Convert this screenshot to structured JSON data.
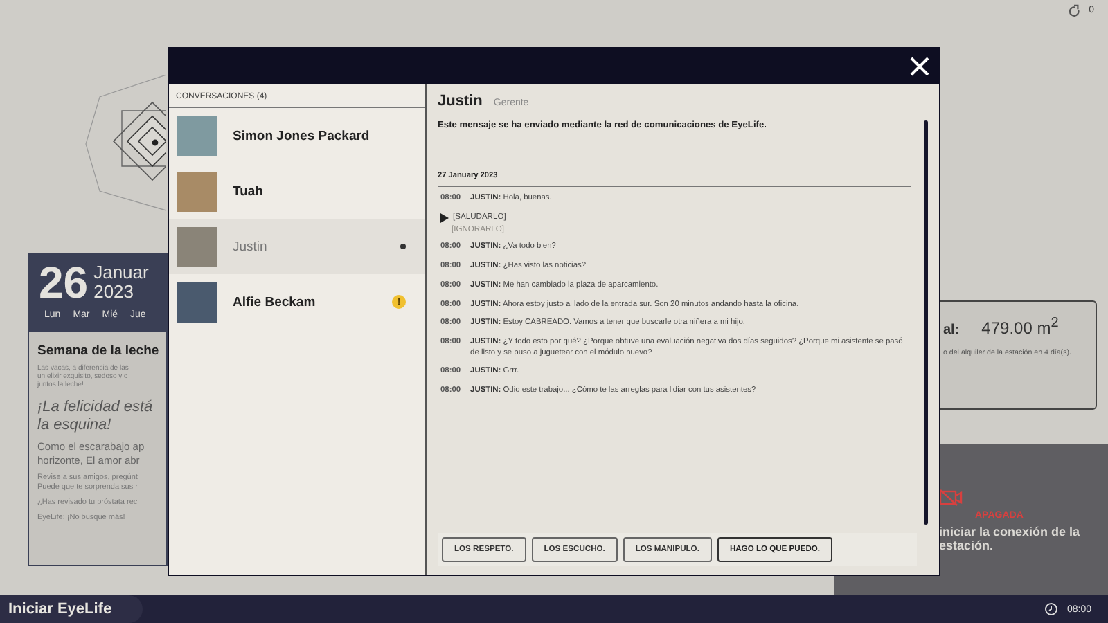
{
  "top_bar": {
    "counter": "0"
  },
  "calendar": {
    "day": "26",
    "month": "Januar",
    "year": "2023",
    "weekdays": [
      "Lun",
      "Mar",
      "Mié",
      "Jue"
    ],
    "title": "Semana de la leche",
    "intro": [
      "Las vacas, a diferencia de las",
      "un elixir exquisito, sedoso y c",
      "juntos la leche!"
    ],
    "slogan": [
      "¡La felicidad está",
      "la esquina!"
    ],
    "body": [
      "Como el escarabajo ap",
      "horizonte, El amor abr"
    ],
    "notes": [
      [
        "Revise a sus amigos, pregúnt",
        "Puede que te sorprenda sus r"
      ],
      [
        "¿Has revisado tu próstata rec"
      ],
      [
        "EyeLife: ¡No busque más!"
      ]
    ]
  },
  "stats": {
    "label": "al:",
    "value": "479.00 m$^{2}$",
    "note": "o del alquiler de la estación en 4 día(s)."
  },
  "connection": {
    "status": "APAGADA",
    "message": "iniciar la conexión de la estación."
  },
  "modal": {
    "list_title": "CONVERSACIONES (4)",
    "conversations": [
      {
        "name": "Simon Jones Packard",
        "selected": false,
        "unread": false
      },
      {
        "name": "Tuah",
        "selected": false,
        "unread": false
      },
      {
        "name": "Justin",
        "selected": true,
        "unread": true
      },
      {
        "name": "Alfie Beckam",
        "selected": false,
        "unread": false,
        "alert": "!"
      }
    ],
    "contact": {
      "name": "Justin",
      "role": "Gerente"
    },
    "notice": "Este mensaje se ha enviado mediante la red de comunicaciones de EyeLife.",
    "date": "27 January 2023",
    "messages": [
      {
        "kind": "line",
        "time": "08:00",
        "speaker": "JUSTIN:",
        "text": "Hola, buenas."
      },
      {
        "kind": "choices",
        "options": [
          {
            "label": "[SALUDARLO]",
            "selected": true,
            "disabled": false
          },
          {
            "label": "[IGNORARLO]",
            "selected": false,
            "disabled": true
          }
        ]
      },
      {
        "kind": "line",
        "time": "08:00",
        "speaker": "JUSTIN:",
        "text": "¿Va todo bien?"
      },
      {
        "kind": "line",
        "time": "08:00",
        "speaker": "JUSTIN:",
        "text": "¿Has visto las noticias?"
      },
      {
        "kind": "line",
        "time": "08:00",
        "speaker": "JUSTIN:",
        "text": "Me han cambiado la plaza de aparcamiento."
      },
      {
        "kind": "line",
        "time": "08:00",
        "speaker": "JUSTIN:",
        "text": "Ahora estoy justo al lado de la entrada sur. Son 20 minutos andando hasta la oficina."
      },
      {
        "kind": "line",
        "time": "08:00",
        "speaker": "JUSTIN:",
        "text": "Estoy CABREADO. Vamos a tener que buscarle otra niñera a mi hijo."
      },
      {
        "kind": "line",
        "time": "08:00",
        "speaker": "JUSTIN:",
        "text": "¿Y todo esto por qué? ¿Porque obtuve una evaluación negativa dos días seguidos? ¿Porque mi asistente se pasó de listo y se puso a juguetear con el módulo nuevo?"
      },
      {
        "kind": "line",
        "time": "08:00",
        "speaker": "JUSTIN:",
        "text": "Grrr."
      },
      {
        "kind": "line",
        "time": "08:00",
        "speaker": "JUSTIN:",
        "text": "Odio este trabajo... ¿Cómo te las arreglas para lidiar con tus asistentes?"
      }
    ],
    "replies": [
      {
        "label": "LOS RESPETO.",
        "selected": false
      },
      {
        "label": "LOS ESCUCHO.",
        "selected": false
      },
      {
        "label": "LOS MANIPULO.",
        "selected": false
      },
      {
        "label": "HAGO LO QUE PUEDO.",
        "selected": true
      }
    ]
  },
  "taskbar": {
    "start": "Iniciar EyeLife",
    "time": "08:00"
  }
}
